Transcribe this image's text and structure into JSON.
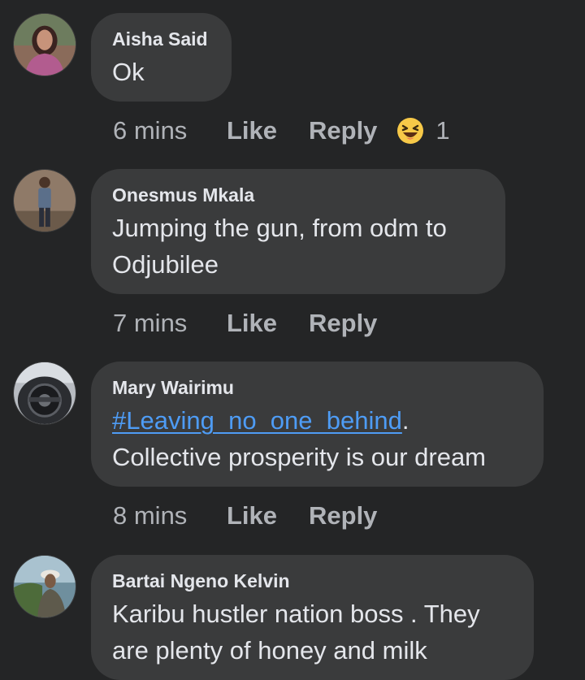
{
  "comments": [
    {
      "author": "Aisha Said",
      "text_lines": [
        "Ok"
      ],
      "time": "6 mins",
      "like_label": "Like",
      "reply_label": "Reply",
      "reaction": {
        "icon": "haha-emoji-icon",
        "count": "1"
      }
    },
    {
      "author": "Onesmus Mkala",
      "text_lines": [
        "Jumping the gun, from odm to",
        "Odjubilee"
      ],
      "time": "7 mins",
      "like_label": "Like",
      "reply_label": "Reply"
    },
    {
      "author": "Mary Wairimu",
      "hashtag": "#Leaving_no_one_behind",
      "hashtag_suffix": ".",
      "text_lines": [
        "Collective prosperity is our dream"
      ],
      "time": "8 mins",
      "like_label": "Like",
      "reply_label": "Reply"
    },
    {
      "author": "Bartai Ngeno Kelvin",
      "text_lines": [
        "Karibu hustler nation boss . They",
        "are plenty of honey and milk"
      ]
    }
  ],
  "colors": {
    "background": "#242526",
    "bubble": "#3a3b3c",
    "text": "#e4e6eb",
    "secondary_text": "#b0b3b8",
    "hashtag": "#4e9cf5",
    "reaction_yellow": "#f7c948"
  }
}
